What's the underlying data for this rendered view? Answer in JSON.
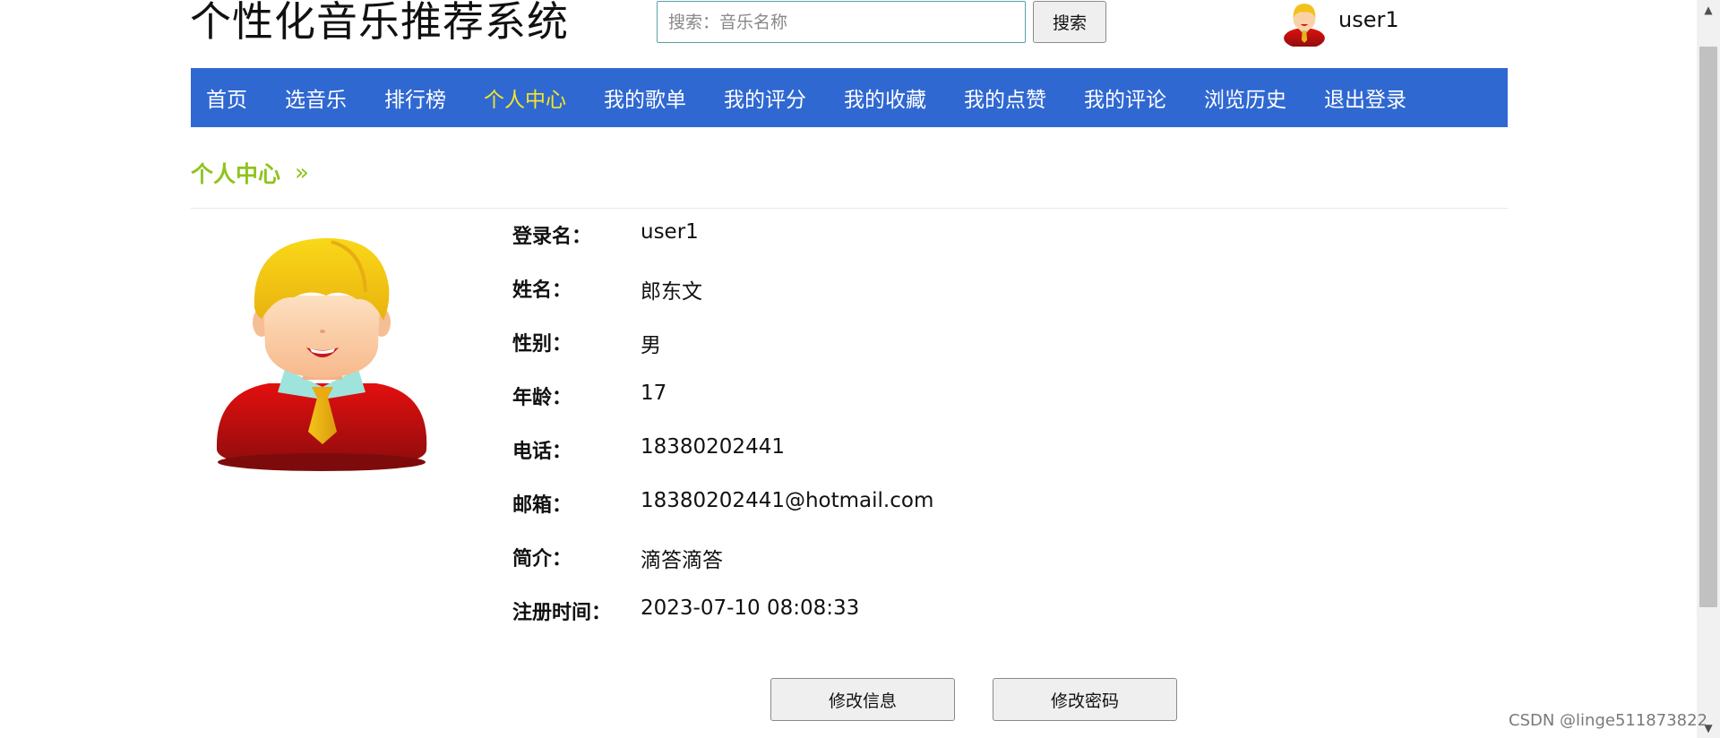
{
  "header": {
    "site_title": "个性化音乐推荐系统",
    "search_placeholder": "搜索：音乐名称",
    "search_value": "",
    "search_button_label": "搜索",
    "username": "user1"
  },
  "nav": {
    "items": [
      {
        "label": "首页",
        "active": false
      },
      {
        "label": "选音乐",
        "active": false
      },
      {
        "label": "排行榜",
        "active": false
      },
      {
        "label": "个人中心",
        "active": true
      },
      {
        "label": "我的歌单",
        "active": false
      },
      {
        "label": "我的评分",
        "active": false
      },
      {
        "label": "我的收藏",
        "active": false
      },
      {
        "label": "我的点赞",
        "active": false
      },
      {
        "label": "我的评论",
        "active": false
      },
      {
        "label": "浏览历史",
        "active": false
      },
      {
        "label": "退出登录",
        "active": false
      }
    ],
    "background_color": "#3068d2",
    "active_color": "#f5e625"
  },
  "breadcrumb": {
    "label": "个人中心",
    "separator": "»",
    "color": "#8fc31f"
  },
  "profile": {
    "rows": [
      {
        "label": "登录名：",
        "value": "user1"
      },
      {
        "label": "姓名：",
        "value": "郎东文"
      },
      {
        "label": "性别：",
        "value": "男"
      },
      {
        "label": "年龄：",
        "value": "17"
      },
      {
        "label": "电话：",
        "value": "18380202441"
      },
      {
        "label": "邮箱：",
        "value": "18380202441@hotmail.com"
      },
      {
        "label": "简介：",
        "value": "滴答滴答"
      },
      {
        "label": "注册时间：",
        "value": "2023-07-10 08:08:33"
      }
    ],
    "edit_info_button": "修改信息",
    "change_password_button": "修改密码"
  },
  "watermark": "CSDN @linge511873822"
}
